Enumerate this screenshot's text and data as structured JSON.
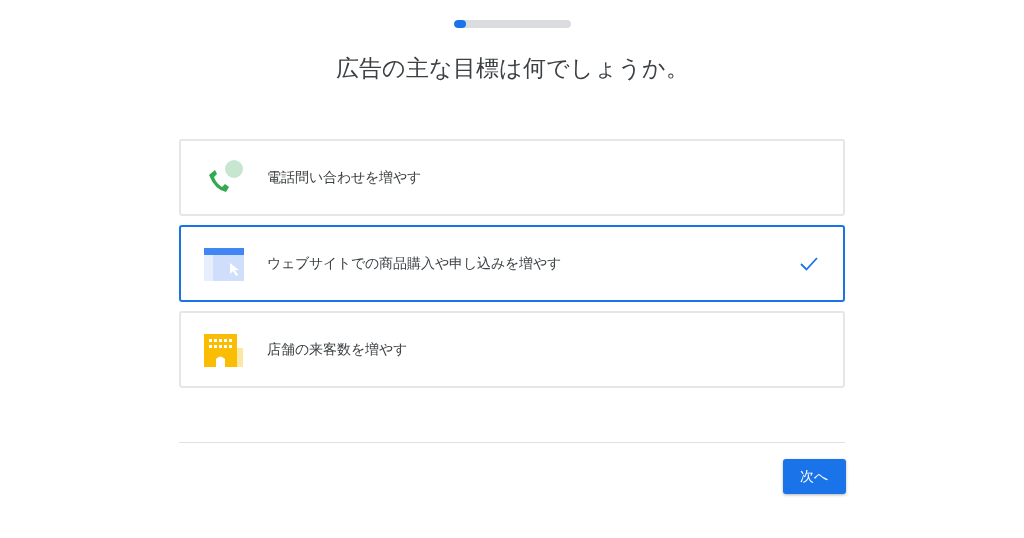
{
  "progress": {
    "level": 0.11
  },
  "title": "広告の主な目標は何でしょうか。",
  "options": [
    {
      "kind": "phone",
      "label": "電話問い合わせを増やす",
      "selected": false
    },
    {
      "kind": "website",
      "label": "ウェブサイトでの商品購入や申し込みを増やす",
      "selected": true
    },
    {
      "kind": "store",
      "label": "店舗の来客数を増やす",
      "selected": false
    }
  ],
  "next_button": "次へ"
}
